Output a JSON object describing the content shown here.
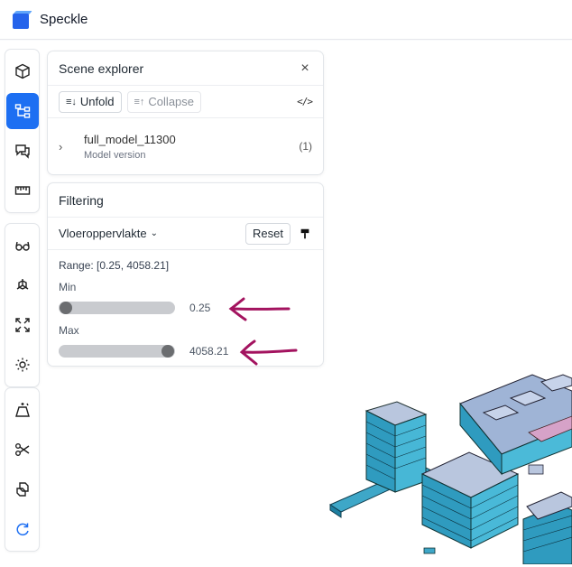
{
  "app": {
    "brand": "Speckle",
    "brand_color": "#2563eb",
    "accent": "#1d6ff2"
  },
  "toolbar": {
    "groups": [
      [
        "cube-icon",
        "scene-tree-icon",
        "chat-icon",
        "ruler-icon"
      ],
      [
        "glasses-icon",
        "axes-icon",
        "expand-icon",
        "sun-icon"
      ],
      [
        "section-box-icon",
        "scissors-icon",
        "explode-icon",
        "reload-icon"
      ]
    ],
    "active": "scene-tree-icon"
  },
  "scene_explorer": {
    "title": "Scene explorer",
    "close": "×",
    "unfold_label": "Unfold",
    "collapse_label": "Collapse",
    "code_toggle": "</>",
    "model": {
      "name": "full_model_11300",
      "subtitle": "Model version",
      "count": "(1)"
    }
  },
  "filtering": {
    "title": "Filtering",
    "property": "Vloeroppervlakte",
    "reset_label": "Reset",
    "range_text": "Range: [0.25, 4058.21]",
    "min_label": "Min",
    "min_value": "0.25",
    "min_fraction": 0,
    "max_label": "Max",
    "max_value": "4058.21",
    "max_fraction": 1,
    "annotation_color": "#a3135f"
  }
}
